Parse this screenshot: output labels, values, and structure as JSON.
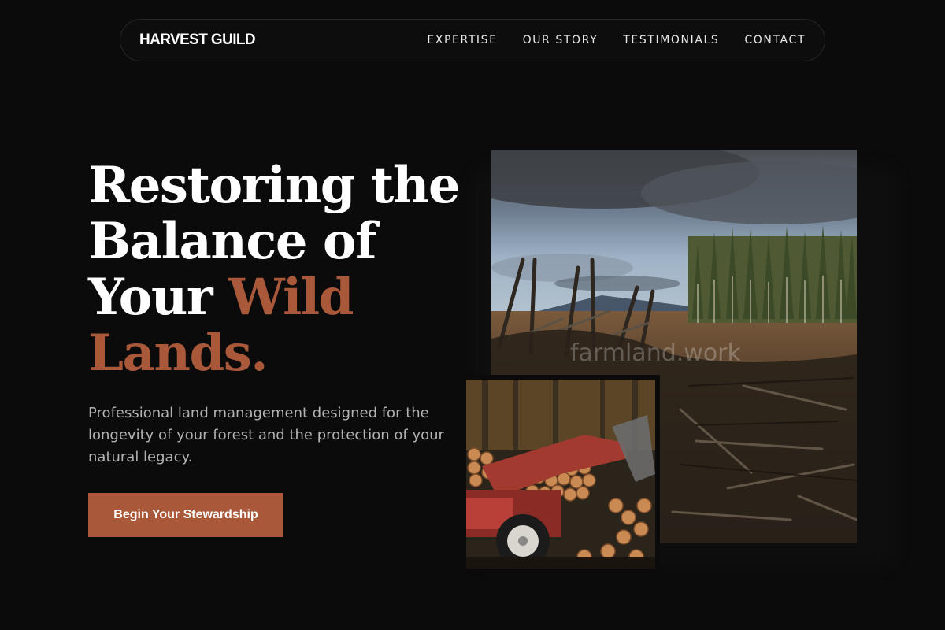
{
  "nav": {
    "brand": "HARVEST GUILD",
    "links": [
      "EXPERTISE",
      "OUR STORY",
      "TESTIMONIALS",
      "CONTACT"
    ]
  },
  "hero": {
    "headline_part1": "Restoring the Balance of Your ",
    "headline_accent": "Wild Lands.",
    "subtext": "Professional land management designed for the longevity of your forest and the protection of your natural legacy.",
    "cta_label": "Begin Your Stewardship"
  },
  "images": {
    "large": {
      "subject": "cleared-forest-landscape",
      "watermark": "farmland.work"
    },
    "small": {
      "subject": "log-loader-with-cut-timber"
    }
  },
  "colors": {
    "background": "#0b0b0b",
    "accent": "#a9593a",
    "text": "#ffffff",
    "muted_text": "#b3b3b3",
    "nav_border": "#262626"
  }
}
